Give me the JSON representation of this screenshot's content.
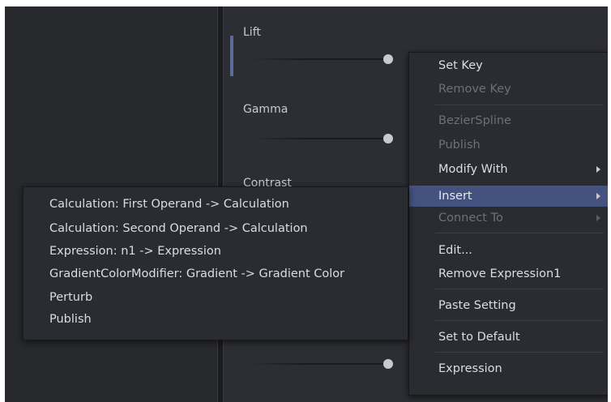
{
  "inspector": {
    "params": [
      {
        "label": "Lift"
      },
      {
        "label": "Gamma"
      },
      {
        "label": "Contrast"
      }
    ]
  },
  "context_menu": {
    "items": [
      {
        "label": "Set Key",
        "enabled": true
      },
      {
        "label": "Remove Key",
        "enabled": false
      },
      {
        "label": "BezierSpline",
        "enabled": false
      },
      {
        "label": "Publish",
        "enabled": false
      },
      {
        "label": "Modify With",
        "enabled": true,
        "submenu": true
      },
      {
        "label": "Insert",
        "enabled": true,
        "submenu": true,
        "highlighted": true
      },
      {
        "label": "Connect To",
        "enabled": false,
        "submenu": true
      },
      {
        "label": "Edit...",
        "enabled": true
      },
      {
        "label": "Remove Expression1",
        "enabled": true
      },
      {
        "label": "Paste Setting",
        "enabled": true
      },
      {
        "label": "Set to Default",
        "enabled": true
      },
      {
        "label": "Expression",
        "enabled": true
      }
    ]
  },
  "insert_submenu": {
    "items": [
      {
        "label": "Calculation: First Operand -> Calculation"
      },
      {
        "label": "Calculation: Second Operand -> Calculation"
      },
      {
        "label": "Expression: n1 -> Expression"
      },
      {
        "label": "GradientColorModifier: Gradient -> Gradient Color"
      },
      {
        "label": "Perturb"
      },
      {
        "label": "Publish"
      }
    ]
  },
  "colors": {
    "highlight": "#43527f",
    "active_marker": "#5c6b9a"
  }
}
